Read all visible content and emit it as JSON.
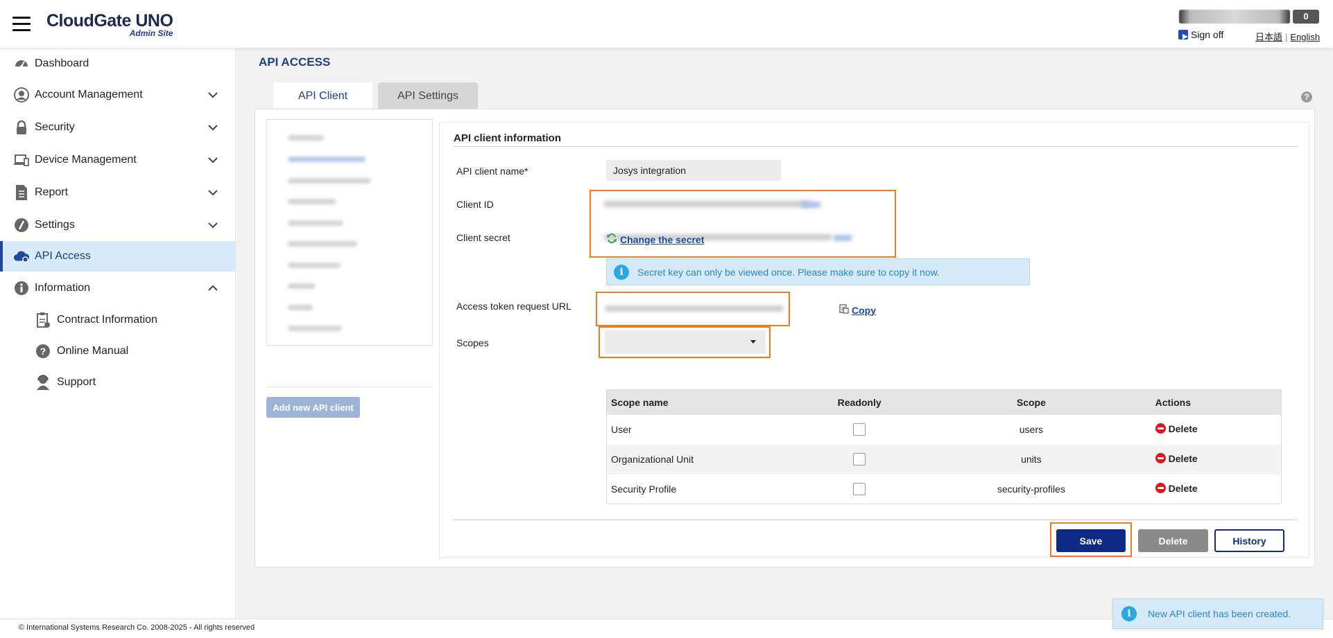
{
  "header": {
    "logo_main": "CloudGate UNO",
    "logo_sub": "Admin Site",
    "user_count": "0",
    "sign_off": "Sign off",
    "lang_ja": "日本語",
    "lang_en": "English",
    "lang_sep": "|"
  },
  "sidebar": {
    "items": [
      {
        "label": "Dashboard",
        "icon": "gauge-icon"
      },
      {
        "label": "Account Management",
        "icon": "user-circle-icon"
      },
      {
        "label": "Security",
        "icon": "lock-icon"
      },
      {
        "label": "Device Management",
        "icon": "laptop-icon"
      },
      {
        "label": "Report",
        "icon": "document-icon"
      },
      {
        "label": "Settings",
        "icon": "settings-icon"
      },
      {
        "label": "API Access",
        "icon": "cloud-gear-icon"
      },
      {
        "label": "Information",
        "icon": "info-icon"
      }
    ],
    "sub_items": [
      {
        "label": "Contract Information",
        "icon": "clipboard-icon"
      },
      {
        "label": "Online Manual",
        "icon": "question-icon"
      },
      {
        "label": "Support",
        "icon": "headset-icon"
      }
    ]
  },
  "main": {
    "page_title": "API ACCESS",
    "tabs": [
      {
        "label": "API Client"
      },
      {
        "label": "API Settings"
      }
    ],
    "help": "?",
    "add_client": "Add new API client",
    "info": {
      "title": "API client information",
      "name_label": "API client name*",
      "name_value": "Josys integration",
      "client_id_label": "Client ID",
      "client_secret_label": "Client secret",
      "change_secret": "Change the secret",
      "notice": "Secret key can only be viewed once. Please make sure to copy it now.",
      "token_url_label": "Access token request URL",
      "copy": "Copy",
      "scopes_label": "Scopes"
    },
    "scope_table": {
      "headers": [
        "Scope name",
        "Readonly",
        "Scope",
        "Actions"
      ],
      "rows": [
        {
          "name": "User",
          "readonly": false,
          "scope": "users",
          "action": "Delete"
        },
        {
          "name": "Organizational Unit",
          "readonly": false,
          "scope": "units",
          "action": "Delete"
        },
        {
          "name": "Security Profile",
          "readonly": false,
          "scope": "security-profiles",
          "action": "Delete"
        }
      ]
    },
    "buttons": {
      "save": "Save",
      "delete": "Delete",
      "history": "History"
    }
  },
  "footer": {
    "copyright": "© International Systems Research Co.   2008-2025 - All rights reserved"
  },
  "toast": {
    "message": "New API client has been created.",
    "icon": "i"
  },
  "colors": {
    "brand_navy": "#0f2a84",
    "highlight_orange": "#f07a22",
    "active_nav_bg": "#d9eaf8",
    "info_blue": "#2aa8e0"
  }
}
